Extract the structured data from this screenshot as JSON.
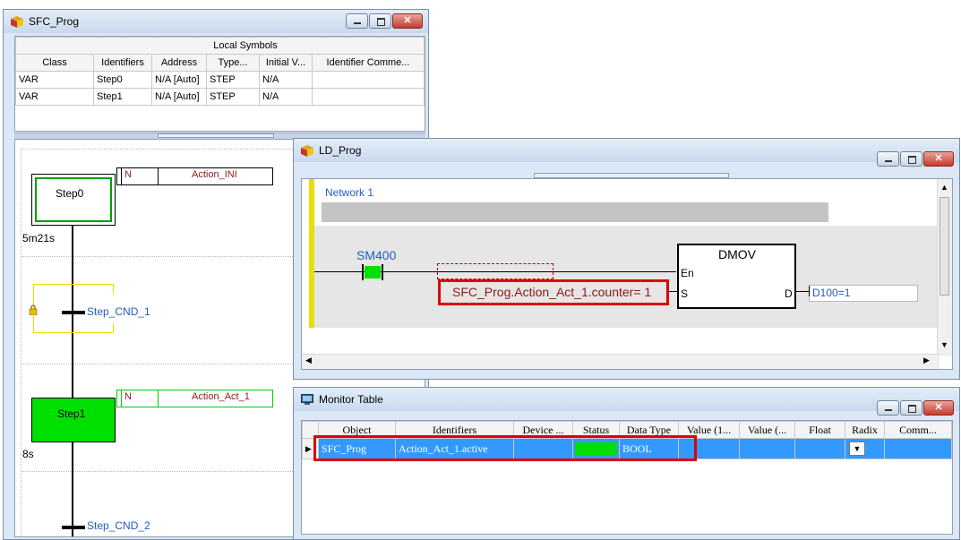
{
  "sfc_window": {
    "title": "SFC_Prog",
    "symbols_title": "Local Symbols",
    "columns": [
      "Class",
      "Identifiers",
      "Address",
      "Type...",
      "Initial V...",
      "Identifier Comme..."
    ],
    "rows": [
      [
        "VAR",
        "Step0",
        "N/A [Auto]",
        "STEP",
        "N/A",
        ""
      ],
      [
        "VAR",
        "Step1",
        "N/A [Auto]",
        "STEP",
        "N/A",
        ""
      ]
    ],
    "step0": {
      "label": "Step0",
      "timer": "5m21s",
      "action_qualifier": "N",
      "action_name": "Action_INI"
    },
    "transition1": {
      "label": "Step_CND_1"
    },
    "step1": {
      "label": "Step1",
      "timer": "8s",
      "action_qualifier": "N",
      "action_name": "Action_Act_1"
    },
    "transition2": {
      "label": "Step_CND_2"
    }
  },
  "ld_window": {
    "title": "LD_Prog",
    "network_label": "Network 1",
    "contact_label": "SM400",
    "block_name": "DMOV",
    "pin_en": "En",
    "pin_s": "S",
    "pin_d": "D",
    "source_value": "SFC_Prog.Action_Act_1.counter= 1",
    "dest_value": "D100=1"
  },
  "monitor_window": {
    "title": "Monitor Table",
    "columns": [
      "Object",
      "Identifiers",
      "Device ...",
      "Status",
      "Data Type",
      "Value (1...",
      "Value (...",
      "Float",
      "Radix",
      "Comm..."
    ],
    "row": {
      "object": "SFC_Prog",
      "identifier": "Action_Act_1.active",
      "device": "",
      "data_type": "BOOL"
    }
  },
  "colors": {
    "active_step": "#00e000",
    "highlight": "#e00000",
    "selection": "#3399ff",
    "variable_text": "#8b1a1a",
    "label_blue": "#1f5fbf"
  }
}
